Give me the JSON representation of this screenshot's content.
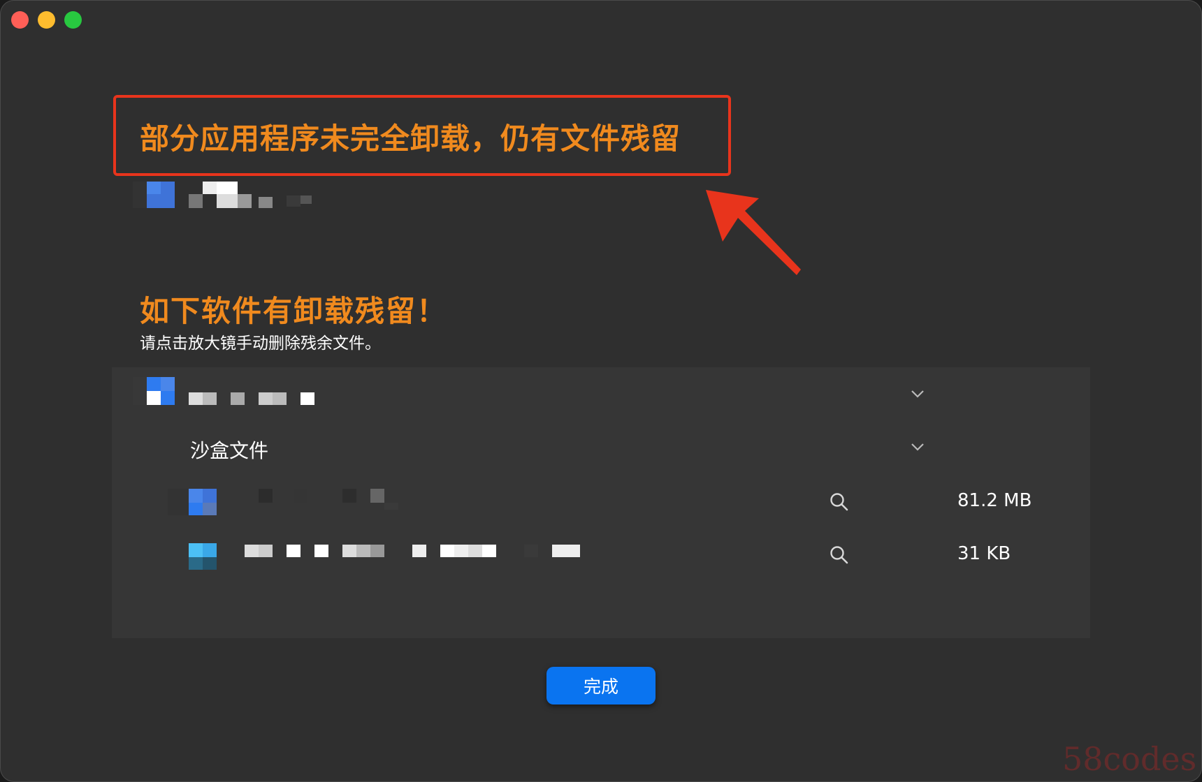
{
  "annotation": {
    "callout_text": "部分应用程序未完全卸载，仍有文件残留"
  },
  "main": {
    "heading": "如下软件有卸载残留！",
    "subheading": "请点击放大镜手动删除残余文件。"
  },
  "panel": {
    "section_label": "沙盒文件",
    "files": [
      {
        "size": "81.2 MB"
      },
      {
        "size": "31 KB"
      }
    ]
  },
  "footer": {
    "done_label": "完成"
  },
  "watermark": "58codes",
  "colors": {
    "accent_orange": "#f08a1e",
    "annotation_red": "#e8341c",
    "button_blue": "#0a74f0",
    "window_bg": "#2f2f2f"
  }
}
